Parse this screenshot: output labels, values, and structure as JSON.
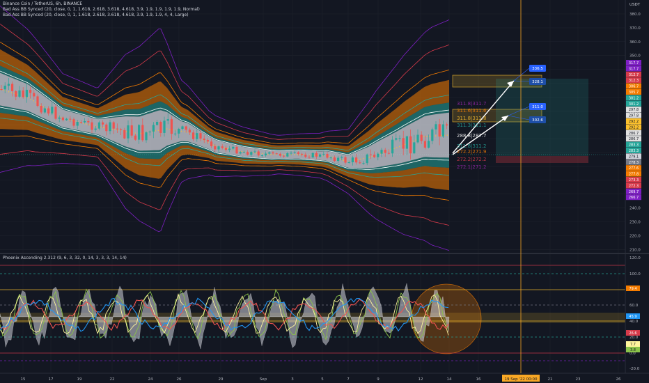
{
  "header": {
    "symbol": "Binance Coin / TetherUS, 6h, BINANCE",
    "indicator_1": "Bad Ass BB Synced (20, close, 0, 1, 1.618, 2.618, 3.618, 4.618, 3.9, 1.9, 1.9, 1.9, 1.9, Normal)",
    "indicator_2": "Bad Ass BB Synced (20, close, 0, 1, 1.618, 2.618, 3.618, 4.618, 3.9, 1.9, 1.9, 4, 4, Large)"
  },
  "oscillator": {
    "title": "Phoenix Ascending 2.312 (9, 6, 3, 32, 0, 14, 3, 3, 3, 14, 14)"
  },
  "price_axis": {
    "currency": "USDT",
    "ticks": [
      "380.0",
      "370.0",
      "360.0",
      "350.0",
      "340.0",
      "330.0",
      "320.0",
      "310.0",
      "300.0",
      "290.0",
      "280.0",
      "270.0",
      "260.0",
      "250.0",
      "240.0",
      "230.0",
      "220.0",
      "210.0"
    ]
  },
  "osc_axis": {
    "ticks": [
      "120.0",
      "100.0",
      "80.0",
      "60.0",
      "40.0",
      "20.0",
      "0.0",
      "-20.0"
    ]
  },
  "time_axis": {
    "labels": [
      "15",
      "17",
      "19",
      "22",
      "24",
      "26",
      "29",
      "Sep",
      "3",
      "5",
      "7",
      "9",
      "12",
      "14",
      "16",
      "21",
      "23",
      "26"
    ]
  },
  "crosshair_time": "19 Sep '22   00:00",
  "price_labels": [
    {
      "text": "317.7",
      "color": "#7e1fc4"
    },
    {
      "text": "317.7",
      "color": "#7e1fc4"
    },
    {
      "text": "312.7",
      "color": "#d73a4a"
    },
    {
      "text": "312.3",
      "color": "#d73a4a"
    },
    {
      "text": "306.7",
      "color": "#f57c00"
    },
    {
      "text": "305.7",
      "color": "#f57c00"
    },
    {
      "text": "301.2",
      "color": "#26a69a"
    },
    {
      "text": "301.2",
      "color": "#26a69a"
    },
    {
      "text": "297.8",
      "color": "#e0e0e0"
    },
    {
      "text": "297.8",
      "color": "#e0e0e0"
    },
    {
      "text": "292.2",
      "color": "#fbc02d"
    },
    {
      "text": "292.2",
      "color": "#fbc02d"
    },
    {
      "text": "286.7",
      "color": "#e0e0e0"
    },
    {
      "text": "286.7",
      "color": "#e0e0e0"
    },
    {
      "text": "283.3",
      "color": "#26a69a"
    },
    {
      "text": "283.3",
      "color": "#26a69a"
    },
    {
      "text": "279.1",
      "color": "#d1d4dc"
    },
    {
      "text": "278.3",
      "color": "#787b86"
    },
    {
      "text": "277.6",
      "color": "#f57c00"
    },
    {
      "text": "277.8",
      "color": "#f57c00"
    },
    {
      "text": "273.3",
      "color": "#d73a4a"
    },
    {
      "text": "272.3",
      "color": "#d73a4a"
    },
    {
      "text": "269.7",
      "color": "#7e1fc4"
    },
    {
      "text": "266.7",
      "color": "#7e1fc4"
    }
  ],
  "osc_labels": [
    {
      "text": "79.4",
      "color": "#f57c00"
    },
    {
      "text": "45.9",
      "color": "#2196f3"
    },
    {
      "text": "26.6",
      "color": "#d73a4a"
    },
    {
      "text": "7.7",
      "color": "#fff59d"
    },
    {
      "text": "3.8",
      "color": "#8bc34a"
    }
  ],
  "callouts": [
    {
      "text": "336.5"
    },
    {
      "text": "328.1"
    },
    {
      "text": "311.0"
    },
    {
      "text": "302.6"
    }
  ],
  "chart_labels": [
    {
      "text": "311.8|311.7",
      "color": "#9c27b0"
    },
    {
      "text": "311.6|311.6",
      "color": "#f57c00"
    },
    {
      "text": "311.8|311.8",
      "color": "#fbc02d"
    },
    {
      "text": "311.3|311.1",
      "color": "#26a69a"
    },
    {
      "text": "288.8|287.7",
      "color": "#ffffff"
    },
    {
      "text": "311.8|311.2",
      "color": "#26a69a"
    },
    {
      "text": "272.2|271.9",
      "color": "#f57c00"
    },
    {
      "text": "272.2|272.2",
      "color": "#d73a4a"
    },
    {
      "text": "272.1|271.2",
      "color": "#9c27b0"
    }
  ]
}
